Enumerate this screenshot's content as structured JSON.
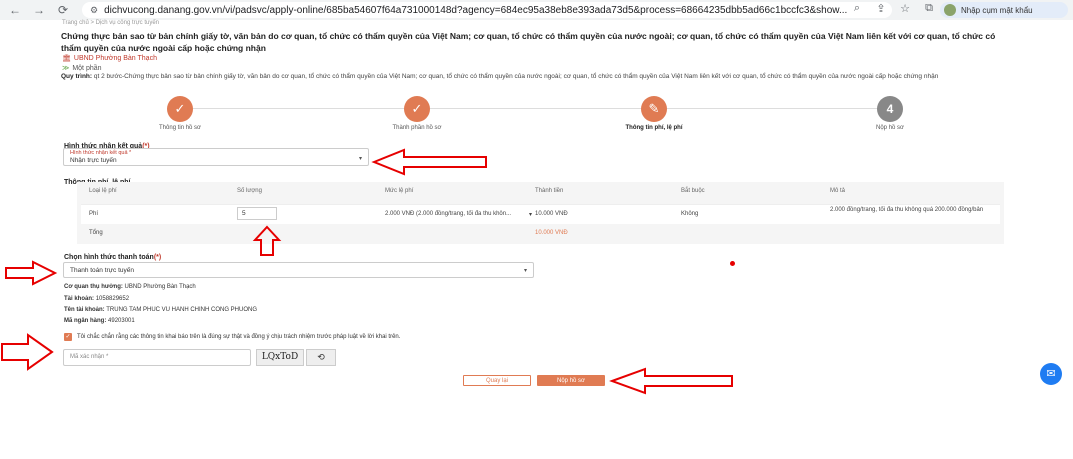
{
  "browser": {
    "url": "dichvucong.danang.gov.vn/vi/padsvc/apply-online/685ba54607f64a731000148d?agency=684ec95a38eb8e393ada73d5&process=68664235dbb5ad66c1bccfc3&show...",
    "profile_label": "Nhập cụm mật khẩu"
  },
  "breadcrumb": "Trang chủ > Dịch vụ công trực tuyến",
  "title": "Chứng thực bản sao từ bản chính giấy tờ, văn bản do cơ quan, tổ chức có thẩm quyền của Việt Nam; cơ quan, tổ chức có thẩm quyền của nước ngoài; cơ quan, tổ chức có thẩm quyền của Việt Nam liên kết với cơ quan, tổ chức có thẩm quyền của nước ngoài cấp hoặc chứng nhận",
  "agency": "UBND Phường Bàn Thạch",
  "level": "Một phần",
  "process_label": "Quy trình:",
  "process_text": "qt 2 bước-Chứng thực bản sao từ bản chính giấy tờ, văn bản do cơ quan, tổ chức có thẩm quyền của Việt Nam; cơ quan, tổ chức có thẩm quyền của nước ngoài; cơ quan, tổ chức có thẩm quyền của Việt Nam liên kết với cơ quan, tổ chức có thẩm quyền của nước ngoài cấp hoặc chứng nhận",
  "steps": [
    {
      "label": "Thông tin hồ sơ",
      "status": "done"
    },
    {
      "label": "Thành phần hồ sơ",
      "status": "done"
    },
    {
      "label": "Thông tin phí, lệ phí",
      "status": "active"
    },
    {
      "label": "Nộp hồ sơ",
      "status": "todo",
      "number": "4"
    }
  ],
  "result_method": {
    "section_label": "Hình thức nhận kết quả",
    "required_mark": "(*)",
    "float_label": "Hình thức nhận kết quả *",
    "value": "Nhận trực tuyến"
  },
  "fee": {
    "section_label": "Thông tin phí, lệ phí",
    "headers": [
      "Loại lệ phí",
      "Số lượng",
      "Mức lệ phí",
      "Thành tiền",
      "Bắt buộc",
      "Mô tả"
    ],
    "row": {
      "type": "Phí",
      "quantity": "5",
      "rate": "2.000 VNĐ (2.000 đồng/trang, tối đa thu khôn...",
      "amount": "10.000 VNĐ",
      "required": "Không",
      "description": "2.000 đồng/trang, tối đa thu không quá 200.000 đồng/bản"
    },
    "total_label": "Tổng",
    "total_amount": "10.000 VNĐ"
  },
  "payment": {
    "section_label": "Chọn hình thức thanh toán",
    "required_mark": "(*)",
    "value": "Thanh toán trực tuyến"
  },
  "beneficiary": {
    "agency_label": "Cơ quan thụ hưởng:",
    "agency_value": "UBND Phường Bàn Thạch",
    "account_label": "Tài khoản:",
    "account_value": "1058829652",
    "account_name_label": "Tên tài khoản:",
    "account_name_value": "TRUNG TAM PHUC VU HANH CHINH CONG PHUONG",
    "bank_code_label": "Mã ngân hàng:",
    "bank_code_value": "49203001"
  },
  "confirm_text": "Tôi chắc chắn rằng các thông tin khai báo trên là đúng sự thật và đồng ý chịu trách nhiệm trước pháp luật về lời khai trên.",
  "captcha": {
    "placeholder": "Mã xác nhận *",
    "code": "LQxToD"
  },
  "buttons": {
    "back": "Quay lại",
    "submit": "Nộp hồ sơ"
  },
  "colors": {
    "accent": "#e07b53",
    "annotation_red": "#e60000",
    "messenger": "#1f7cf2"
  }
}
